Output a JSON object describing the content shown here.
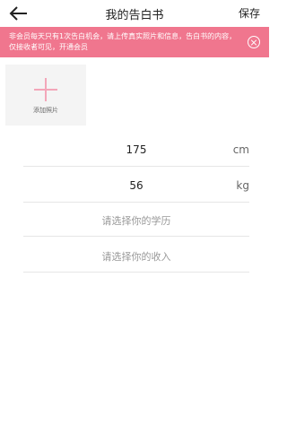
{
  "header": {
    "title": "我的告白书",
    "save_label": "保存"
  },
  "banner": {
    "message": "非会员每天只有1次告白机会，请上传真实照片和信息，告白书的内容，仅接收者可见，开通会员"
  },
  "photo": {
    "add_label": "添加照片"
  },
  "fields": {
    "height": {
      "value": "175",
      "unit": "cm"
    },
    "weight": {
      "value": "56",
      "unit": "kg"
    },
    "education": {
      "placeholder": "请选择你的学历"
    },
    "income": {
      "placeholder": "请选择你的收入"
    }
  }
}
